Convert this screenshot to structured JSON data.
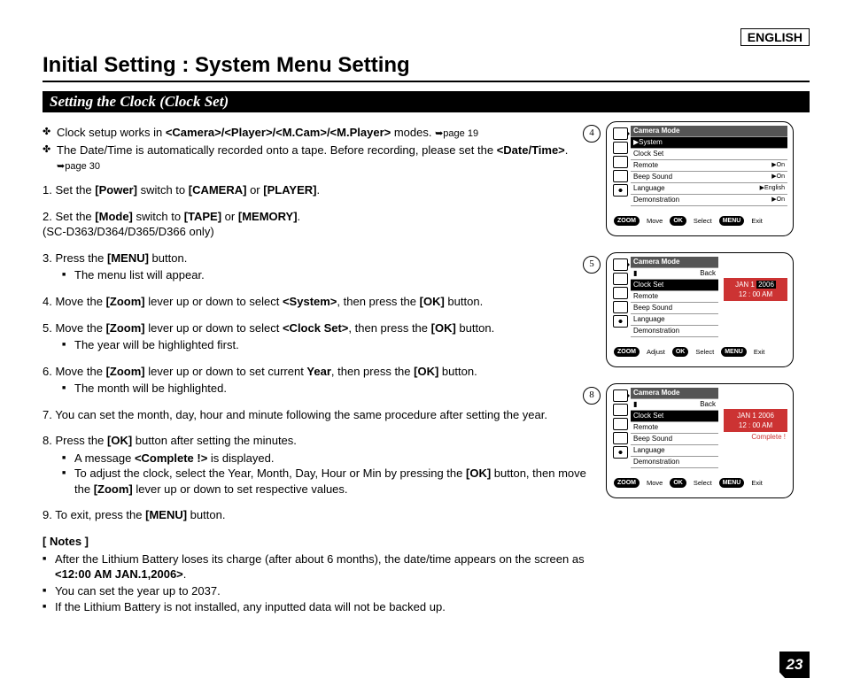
{
  "lang_badge": "ENGLISH",
  "title": "Initial Setting : System Menu Setting",
  "section": "Setting the Clock (Clock Set)",
  "intro": [
    {
      "pre": "Clock setup works in ",
      "b": "<Camera>/<Player>/<M.Cam>/<M.Player>",
      "post": " modes. ",
      "ref": "➥page 19"
    },
    {
      "pre": "The Date/Time is automatically recorded onto a tape. Before recording, please set the ",
      "b": "<Date/Time>",
      "post": ". ",
      "ref": "➥page 30"
    }
  ],
  "steps": [
    {
      "n": "1.",
      "t": "Set the ",
      "b1": "[Power]",
      "t2": " switch to ",
      "b2": "[CAMERA]",
      "t3": " or ",
      "b3": "[PLAYER]",
      "t4": "."
    },
    {
      "n": "2.",
      "t": "Set the ",
      "b1": "[Mode]",
      "t2": " switch to ",
      "b2": "[TAPE]",
      "t3": " or ",
      "b3": "[MEMORY]",
      "t4": ".",
      "extra": "(SC-D363/D364/D365/D366 only)"
    },
    {
      "n": "3.",
      "t": "Press the ",
      "b1": "[MENU]",
      "t2": " button.",
      "sub": [
        "The menu list will appear."
      ]
    },
    {
      "n": "4.",
      "t": "Move the ",
      "b1": "[Zoom]",
      "t2": " lever up or down to select ",
      "b2": "<System>",
      "t3": ", then press the ",
      "b3": "[OK]",
      "t4": " button."
    },
    {
      "n": "5.",
      "t": "Move the ",
      "b1": "[Zoom]",
      "t2": " lever up or down to select ",
      "b2": "<Clock Set>",
      "t3": ", then press the ",
      "b3": "[OK]",
      "t4": " button.",
      "sub": [
        "The year will be highlighted first."
      ]
    },
    {
      "n": "6.",
      "t": "Move the ",
      "b1": "[Zoom]",
      "t2": " lever up or down to set current ",
      "b2": "Year",
      "t3": ", then press the ",
      "b3": "[OK]",
      "t4": " button.",
      "sub": [
        "The month will be highlighted."
      ]
    },
    {
      "n": "7.",
      "t": "You can set the month, day, hour and minute following the same procedure after setting the year."
    },
    {
      "n": "8.",
      "t": "Press the ",
      "b1": "[OK]",
      "t2": " button after setting the minutes.",
      "sub": [
        "A message <Complete !> is displayed.",
        "To adjust the clock, select the Year, Month, Day, Hour or Min by pressing the [OK] button, then move the [Zoom] lever up or down to set respective values."
      ]
    },
    {
      "n": "9.",
      "t": "To exit, press the ",
      "b1": "[MENU]",
      "t2": " button."
    }
  ],
  "notes_h": "[ Notes ]",
  "notes": [
    "After the Lithium Battery loses its charge (after about 6 months), the date/time appears on the screen as <12:00 AM JAN.1,2006>.",
    "You can set the year up to 2037.",
    "If the Lithium Battery is not installed, any inputted data will not be backed up."
  ],
  "screens": {
    "common": {
      "mode": "Camera Mode",
      "items": [
        "Clock Set",
        "Remote",
        "Beep Sound",
        "Language",
        "Demonstration"
      ],
      "nav_zoom": "ZOOM",
      "nav_ok": "OK",
      "nav_menu": "MENU",
      "nav_select": "Select",
      "nav_exit": "Exit"
    },
    "s4": {
      "circ": "4",
      "header": "▶System",
      "vals": [
        "",
        "▶On",
        "▶On",
        "▶English",
        "▶On"
      ],
      "nav_action": "Move"
    },
    "s5": {
      "circ": "5",
      "header": "Back",
      "hi": "Clock Set",
      "date_line1_pre": "JAN  1",
      "year": "2006",
      "date_line2": "12 : 00   AM",
      "nav_action": "Adjust"
    },
    "s8": {
      "circ": "8",
      "header": "Back",
      "hi": "Clock Set",
      "date_line1": "JAN  1   2006",
      "date_line2": "12 : 00   AM",
      "complete": "Complete !",
      "nav_action": "Move"
    }
  },
  "page_num": "23"
}
